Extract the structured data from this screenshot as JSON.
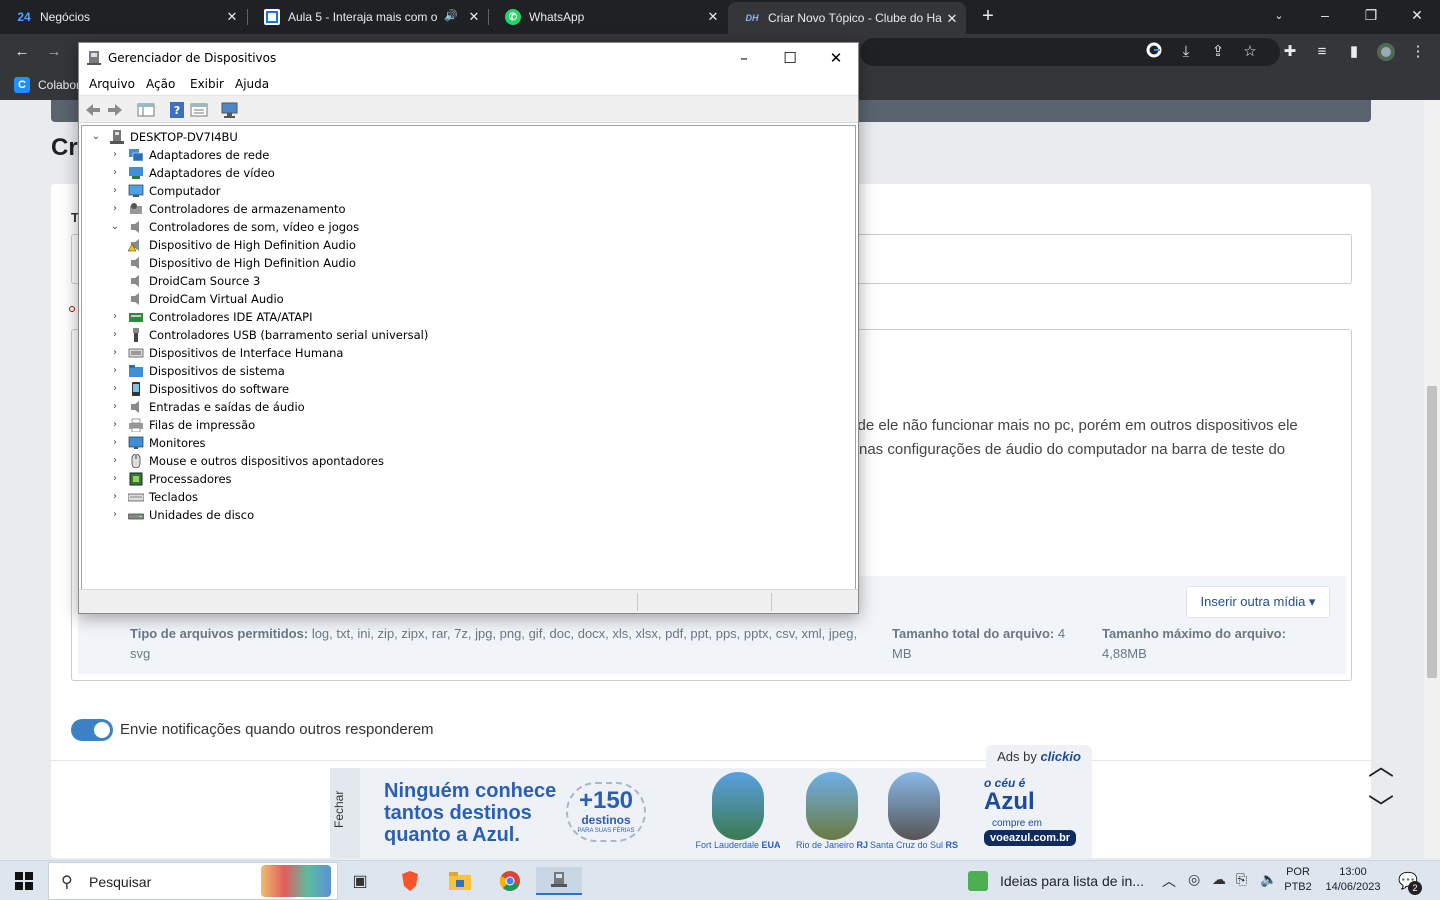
{
  "browser": {
    "tabs": [
      {
        "label": "Negócios",
        "icon": "24"
      },
      {
        "label": "Aula 5 - Interaja mais com o",
        "icon": ""
      },
      {
        "label": "WhatsApp",
        "icon": ""
      },
      {
        "label": "Criar Novo Tópico - Clube do Ha",
        "icon": "DH"
      }
    ],
    "new_tab": "+",
    "bookmark": "Colabor"
  },
  "page": {
    "heading": "Cr",
    "field_label": "T",
    "body_line1": "a de ele não funcionar mais no pc, porém em outros dispositivos ele",
    "body_line2": "nas configurações de áudio do computador na barra de teste do",
    "insert_media": "Inserir outra mídia",
    "allowed_label": "Tipo de arquivos permitidos:",
    "allowed_values": "log, txt, ini, zip, zipx, rar, 7z, jpg, png, gif, doc, docx, xls, xlsx, pdf, ppt, pps, pptx, csv, xml, jpeg,",
    "allowed_values2": "svg",
    "total_size_label": "Tamanho total do arquivo:",
    "total_size_value": "4",
    "total_size_unit": "MB",
    "max_size_label": "Tamanho máximo do arquivo:",
    "max_size_value": "4,88MB",
    "notify_label": "Envie notificações quando outros responderem",
    "notify_on": true
  },
  "devmgr": {
    "title": "Gerenciador de Dispositivos",
    "menus": [
      "Arquivo",
      "Ação",
      "Exibir",
      "Ajuda"
    ],
    "root": "DESKTOP-DV7I4BU",
    "nodes": [
      {
        "label": "Adaptadores de rede",
        "icon": "network-icon",
        "level": 1,
        "expander": "›"
      },
      {
        "label": "Adaptadores de vídeo",
        "icon": "display-adapter-icon",
        "level": 1,
        "expander": "›"
      },
      {
        "label": "Computador",
        "icon": "computer-icon",
        "level": 1,
        "expander": "›"
      },
      {
        "label": "Controladores de armazenamento",
        "icon": "storage-icon",
        "level": 1,
        "expander": "›"
      },
      {
        "label": "Controladores de som, vídeo e jogos",
        "icon": "speaker-icon",
        "level": 1,
        "expander": "⌄"
      },
      {
        "label": "Dispositivo de High Definition Audio",
        "icon": "speaker-warning-icon",
        "level": 2,
        "expander": ""
      },
      {
        "label": "Dispositivo de High Definition Audio",
        "icon": "speaker-icon",
        "level": 2,
        "expander": ""
      },
      {
        "label": "DroidCam Source 3",
        "icon": "speaker-icon",
        "level": 2,
        "expander": ""
      },
      {
        "label": "DroidCam Virtual Audio",
        "icon": "speaker-icon",
        "level": 2,
        "expander": ""
      },
      {
        "label": "Controladores IDE ATA/ATAPI",
        "icon": "ide-icon",
        "level": 1,
        "expander": "›"
      },
      {
        "label": "Controladores USB (barramento serial universal)",
        "icon": "usb-icon",
        "level": 1,
        "expander": "›"
      },
      {
        "label": "Dispositivos de Interface Humana",
        "icon": "hid-icon",
        "level": 1,
        "expander": "›"
      },
      {
        "label": "Dispositivos de sistema",
        "icon": "system-folder-icon",
        "level": 1,
        "expander": "›"
      },
      {
        "label": "Dispositivos do software",
        "icon": "software-device-icon",
        "level": 1,
        "expander": "›"
      },
      {
        "label": "Entradas e saídas de áudio",
        "icon": "speaker-icon",
        "level": 1,
        "expander": "›"
      },
      {
        "label": "Filas de impressão",
        "icon": "printer-icon",
        "level": 1,
        "expander": "›"
      },
      {
        "label": "Monitores",
        "icon": "monitor-icon",
        "level": 1,
        "expander": "›"
      },
      {
        "label": "Mouse e outros dispositivos apontadores",
        "icon": "mouse-icon",
        "level": 1,
        "expander": "›"
      },
      {
        "label": "Processadores",
        "icon": "processor-icon",
        "level": 1,
        "expander": "›"
      },
      {
        "label": "Teclados",
        "icon": "keyboard-icon",
        "level": 1,
        "expander": "›"
      },
      {
        "label": "Unidades de disco",
        "icon": "disk-icon",
        "level": 1,
        "expander": "›"
      }
    ]
  },
  "ad": {
    "ads_by": "Ads by",
    "brand": "clickio",
    "close": "Fechar",
    "headline1": "Ninguém conhece",
    "headline2": "tantos destinos",
    "headline3": "quanto a Azul.",
    "badge_num": "+150",
    "badge_word": "destinos",
    "badge_sub": "PARA SUAS FÉRIAS",
    "destinations": [
      {
        "city": "Fort Lauderdale",
        "region": "EUA"
      },
      {
        "city": "Rio de Janeiro",
        "region": "RJ"
      },
      {
        "city": "Santa Cruz do Sul",
        "region": "RS"
      }
    ],
    "logo_small": "o céu é",
    "logo": "Azul",
    "cta_small": "compre em",
    "cta": "voeazul.com.br"
  },
  "taskbar": {
    "search_placeholder": "Pesquisar",
    "notification_text": "Ideias para lista de in...",
    "lang1": "POR",
    "lang2": "PTB2",
    "time": "13:00",
    "date": "14/06/2023",
    "badge": "2"
  },
  "colors": {
    "accent": "#3b82c4",
    "azul": "#1e4a9a",
    "taskbar": "#dde6ef"
  }
}
